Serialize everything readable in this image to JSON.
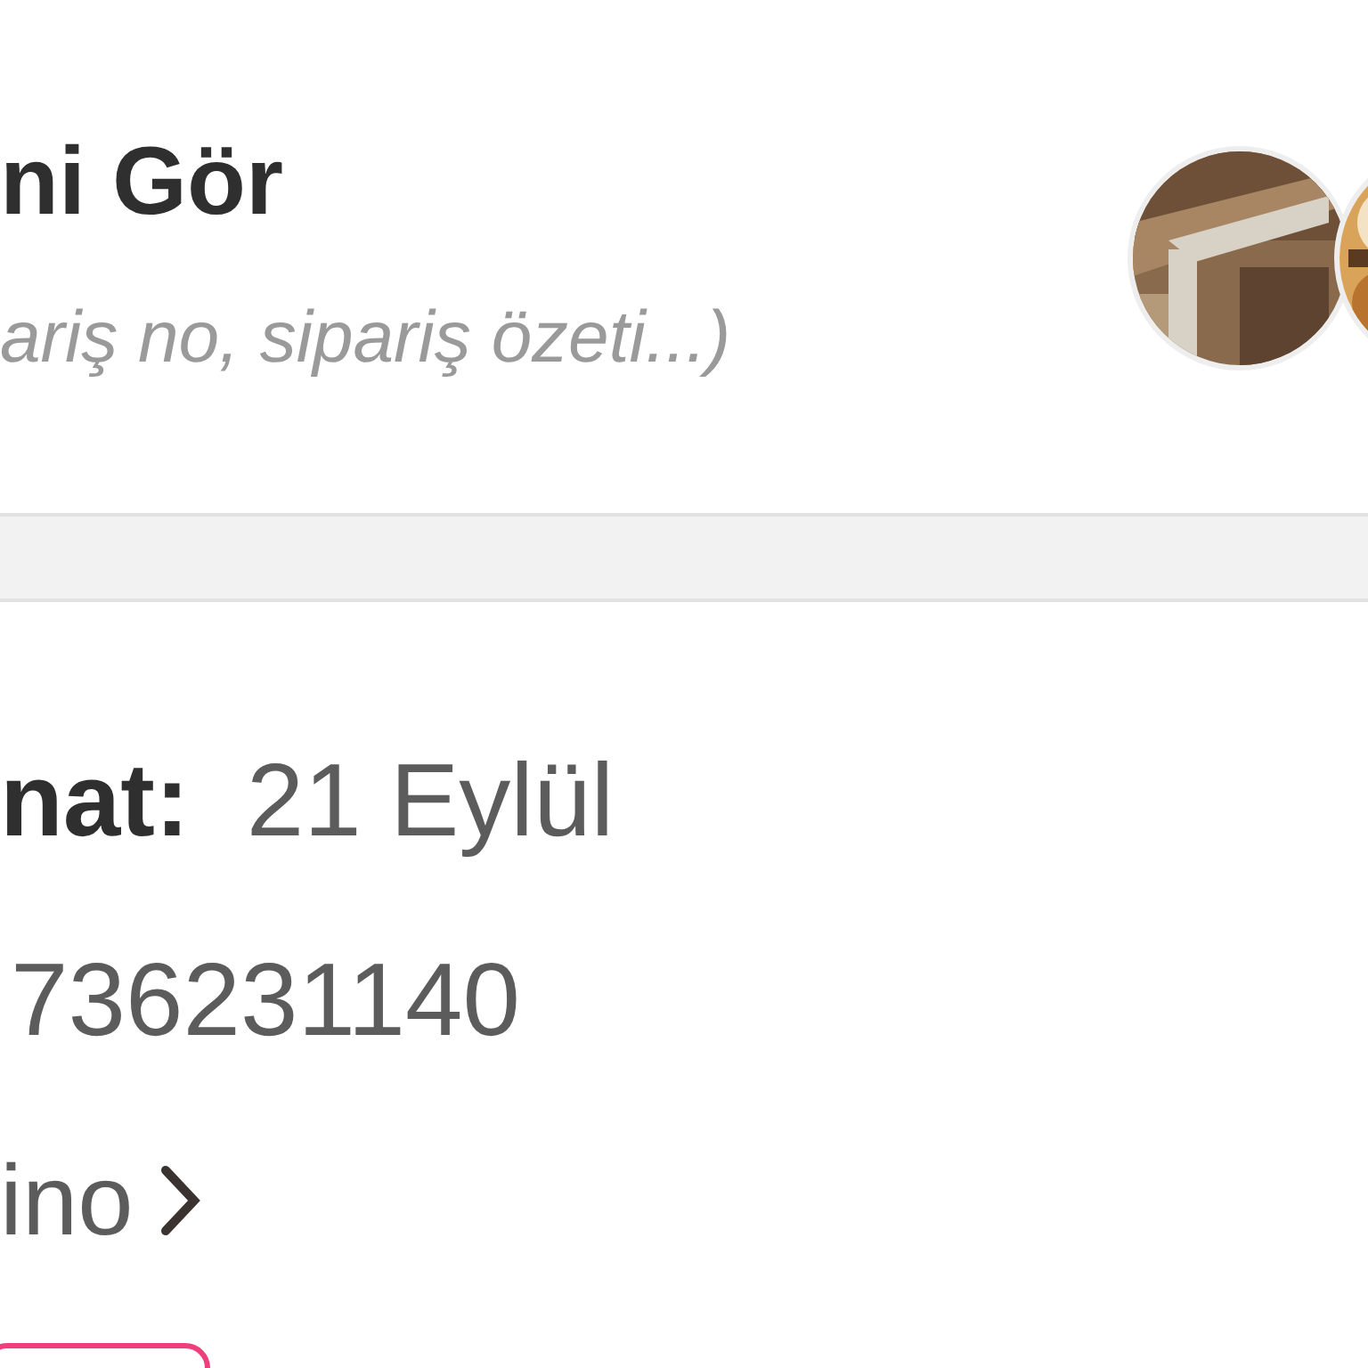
{
  "header": {
    "title": "ni Gör",
    "subtitle": "ariş no, sipariş özeti...)"
  },
  "order": {
    "date_label": "nat:",
    "date_value": "21 Eylül",
    "number": "736231140",
    "link": "ino"
  }
}
